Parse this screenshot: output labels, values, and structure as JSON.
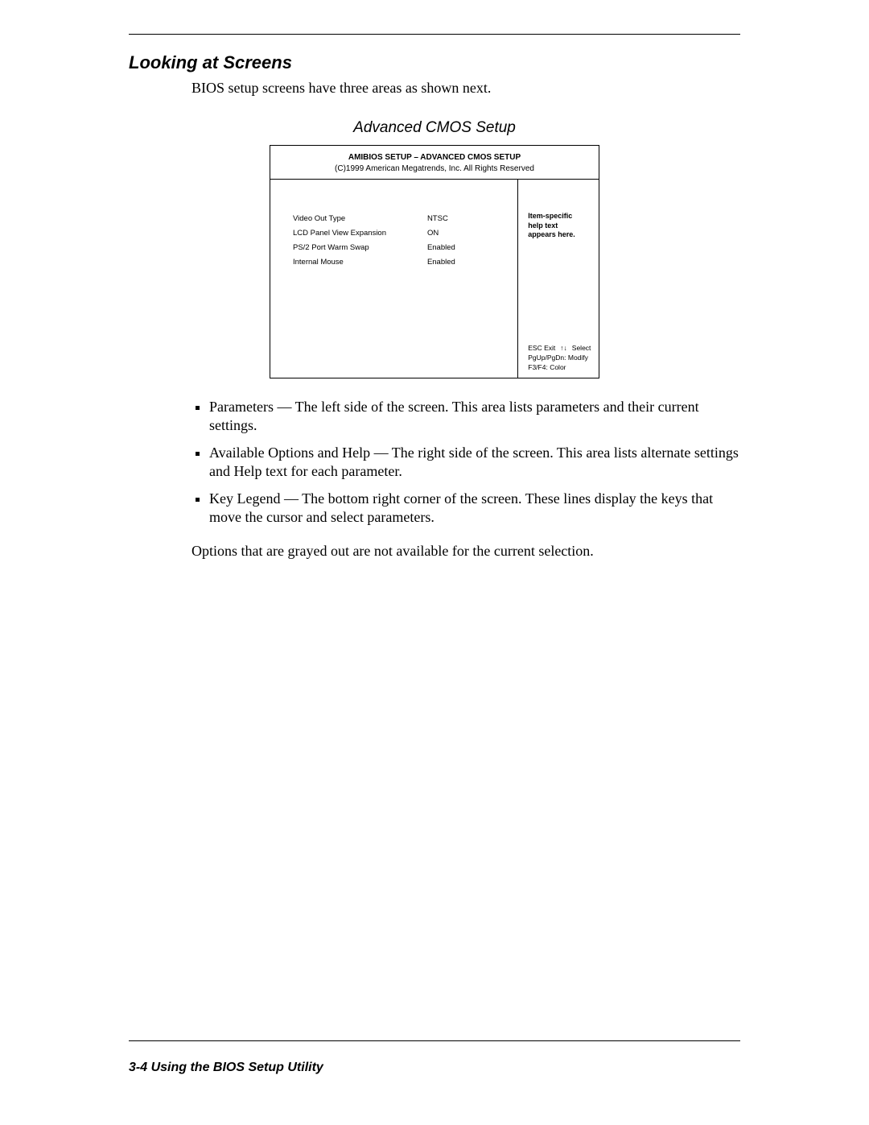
{
  "section_title": "Looking at Screens",
  "intro_text": "BIOS setup screens have three areas as shown next.",
  "figure_title": "Advanced CMOS Setup",
  "bios": {
    "header_line1": "AMIBIOS SETUP – ADVANCED CMOS SETUP",
    "header_line2": "(C)1999 American Megatrends, Inc. All Rights Reserved",
    "params": [
      {
        "name": "Video Out Type",
        "value": "NTSC"
      },
      {
        "name": "LCD Panel View Expansion",
        "value": "ON"
      },
      {
        "name": "PS/2 Port Warm Swap",
        "value": "Enabled"
      },
      {
        "name": "Internal Mouse",
        "value": "Enabled"
      }
    ],
    "help_text_line1": "Item-specific",
    "help_text_line2": "help text",
    "help_text_line3": "appears here.",
    "legend": {
      "esc_exit": "ESC  Exit",
      "arrows": "↑↓",
      "select": "Select",
      "modify": "PgUp/PgDn: Modify",
      "color": "F3/F4: Color"
    }
  },
  "bullets": [
    "Parameters — The left side of the screen. This area lists parameters and their current settings.",
    "Available Options and Help — The right side of the screen. This area lists alternate settings and Help text for each parameter.",
    "Key Legend — The bottom right corner of the screen. These lines display the keys that move the cursor and select parameters."
  ],
  "closing_text": "Options that are grayed out are not available for the current selection.",
  "footer_text": "3-4   Using the BIOS Setup Utility"
}
